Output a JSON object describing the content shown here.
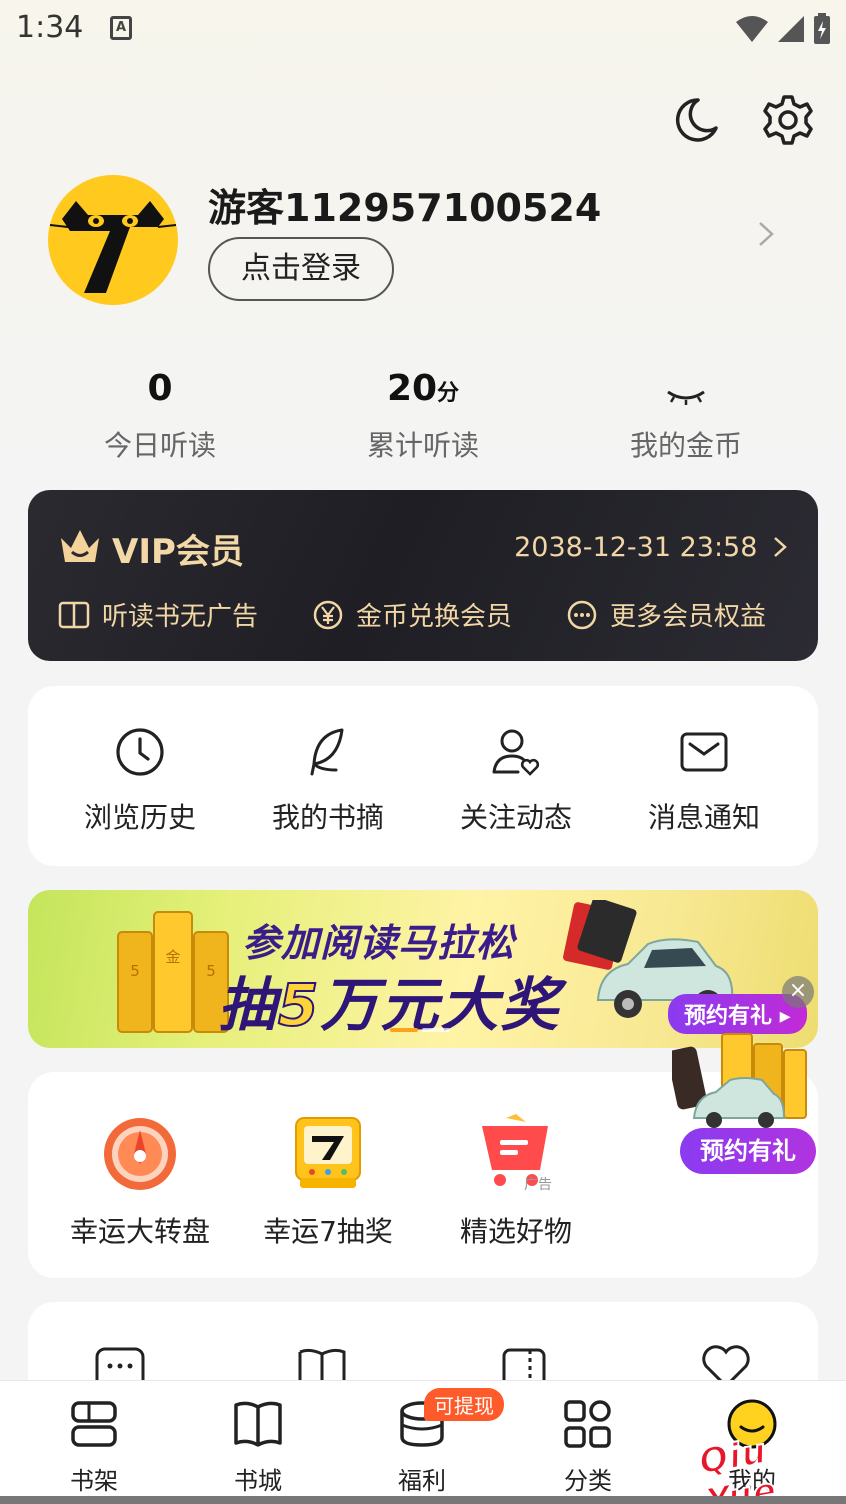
{
  "status_bar": {
    "time": "1:34",
    "notification_icon": "A"
  },
  "header": {
    "icons": [
      "moon-icon",
      "settings-icon"
    ]
  },
  "profile": {
    "username": "游客112957100524",
    "login_label": "点击登录"
  },
  "stats": [
    {
      "value": "0",
      "unit": "",
      "label": "今日听读"
    },
    {
      "value": "20",
      "unit": "分",
      "label": "累计听读"
    },
    {
      "value": "",
      "unit": "",
      "label": "我的金币"
    }
  ],
  "vip": {
    "title": "VIP会员",
    "expire": "2038-12-31 23:58",
    "benefits": [
      "听读书无广告",
      "金币兑换会员",
      "更多会员权益"
    ]
  },
  "quick_links": [
    "浏览历史",
    "我的书摘",
    "关注动态",
    "消息通知"
  ],
  "banner": {
    "line1": "参加阅读马拉松",
    "line2_a": "抽",
    "line2_b": "5",
    "line2_c": "万元大奖",
    "cta": "预约有礼 ▸",
    "gold_text": "5万 金条 5万",
    "close": "×"
  },
  "activities": [
    "幸运大转盘",
    "幸运7抽奖",
    "精选好物"
  ],
  "ad_tag": "广告",
  "float_ad": {
    "label": "预约有礼"
  },
  "tabbar": {
    "items": [
      "书架",
      "书城",
      "福利",
      "分类",
      "我的"
    ],
    "badge": "可提现",
    "active": 4
  },
  "watermark": "Qiu Yue",
  "colors": {
    "vip_gold": "#f1d6a6",
    "accent": "#ffc91e",
    "badge": "#ff5a2a",
    "promo_purple": "#8a3bf0"
  }
}
